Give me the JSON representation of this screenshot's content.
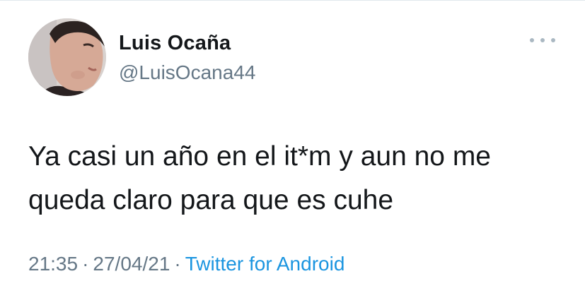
{
  "author": {
    "name": "Luis Ocaña",
    "handle": "@LuisOcana44"
  },
  "tweet": {
    "line1": "Ya casi un año en el it*m y aun no me",
    "line2": "queda claro para que es cuhe"
  },
  "meta": {
    "time": "21:35",
    "date": "27/04/21",
    "separator": "·",
    "source": "Twitter for Android"
  },
  "icons": {
    "more": "more-options-icon",
    "avatar": "profile-photo"
  },
  "colors": {
    "text": "#14171a",
    "secondary": "#657786",
    "link": "#1b95e0"
  }
}
